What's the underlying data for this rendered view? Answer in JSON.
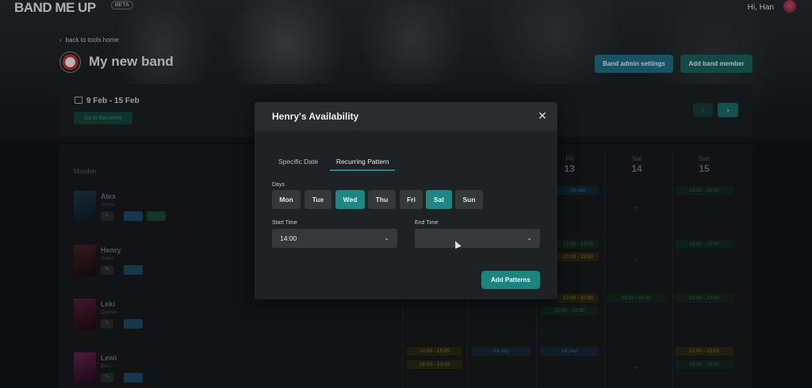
{
  "app": {
    "logo": "BAND ME UP",
    "beta": "BETA",
    "greeting": "Hi, Han"
  },
  "nav": {
    "back": "back to tools home"
  },
  "band": {
    "title": "My new band",
    "admin_button": "Band admin settings",
    "add_member_button": "Add band member"
  },
  "week": {
    "range": "9 Feb - 15 Feb",
    "go_button": "Go to this week",
    "prev": "‹",
    "next": "›"
  },
  "schedule": {
    "member_header": "Member",
    "days": [
      {
        "name": "Fri",
        "num": "13"
      },
      {
        "name": "Sat",
        "num": "14"
      },
      {
        "name": "Sun",
        "num": "15"
      }
    ],
    "members": [
      {
        "name": "Alex",
        "instrument": "Drums"
      },
      {
        "name": "Henry",
        "instrument": "Guitar"
      },
      {
        "name": "Leki",
        "instrument": "Clarinet"
      },
      {
        "name": "Lewi",
        "instrument": "Bass"
      }
    ],
    "slots": {
      "fri_alex": "All day",
      "sun_alex": "13:00 - 23:00",
      "fri_henry_1": "10:00 - 23:00",
      "fri_henry_2": "10:00 - 23:30",
      "sun_henry": "16:00 - 23:00",
      "fri_leki_1": "10:00 - 20:30",
      "fri_leki_2": "20:30 - 23:30",
      "sat_leki": "20:30 - 23:30",
      "sun_leki": "20:30 - 23:30",
      "wed_lewi_1": "10:00 - 15:00",
      "wed_lewi_2": "16:00 - 23:00",
      "thu_lewi": "All day",
      "fri_lewi": "All day",
      "sun_lewi_1": "12:00 - 15:00",
      "sun_lewi_2": "16:00 - 23:00"
    }
  },
  "modal": {
    "title": "Henry's Availability",
    "close": "✕",
    "tabs": {
      "specific": "Specific Date",
      "recurring": "Recurring Pattern"
    },
    "days_label": "Days",
    "days": {
      "mon": "Mon",
      "tue": "Tue",
      "wed": "Wed",
      "thu": "Thu",
      "fri": "Fri",
      "sat": "Sat",
      "sun": "Sun"
    },
    "selected_days": [
      "Wed",
      "Sat"
    ],
    "start_label": "Start Time",
    "start_value": "14:00",
    "end_label": "End Time",
    "end_value": "",
    "submit": "Add Patterns"
  },
  "colors": {
    "accent": "#1b8883",
    "admin": "#1e6f86",
    "modal_bg": "#1f2224"
  }
}
